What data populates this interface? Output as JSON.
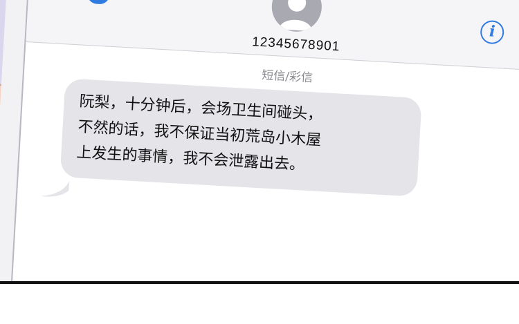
{
  "header": {
    "contact_number": "12345678901",
    "info_label": "i"
  },
  "thread": {
    "label": "短信/彩信"
  },
  "message": {
    "lines": [
      "阮梨，十分钟后，会场卫生间碰头，",
      "不然的话，我不保证当初荒岛小木屋",
      "上发生的事情，我不会泄露出去。"
    ]
  },
  "colors": {
    "accent": "#2f7be0",
    "bubble": "#e4e4e9",
    "label": "#8a8a90"
  }
}
